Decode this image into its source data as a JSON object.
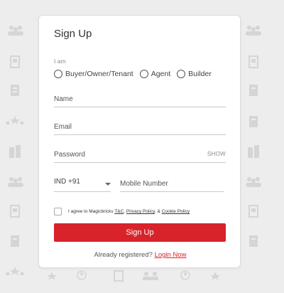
{
  "signup": {
    "title": "Sign Up",
    "role_prompt": "I am",
    "roles": [
      "Buyer/Owner/Tenant",
      "Agent",
      "Builder"
    ],
    "name_placeholder": "Name",
    "email_placeholder": "Email",
    "password_placeholder": "Password",
    "show_label": "SHOW",
    "country_code": "IND +91",
    "mobile_placeholder": "Mobile Number",
    "agree_prefix": "I agree to Magicbricks",
    "agree_tc": "T&C",
    "agree_privacy": "Privacy Policy",
    "agree_and": "&",
    "agree_cookie": "Cookie Policy",
    "submit_label": "Sign Up",
    "already_registered": "Already registered?",
    "login_link": "Login Now"
  },
  "colors": {
    "accent": "#d8232a",
    "background": "#ededed",
    "card": "#ffffff"
  },
  "background_icons": [
    "people-icon",
    "building-icon",
    "stars-icon",
    "document-icon",
    "user-icon"
  ]
}
